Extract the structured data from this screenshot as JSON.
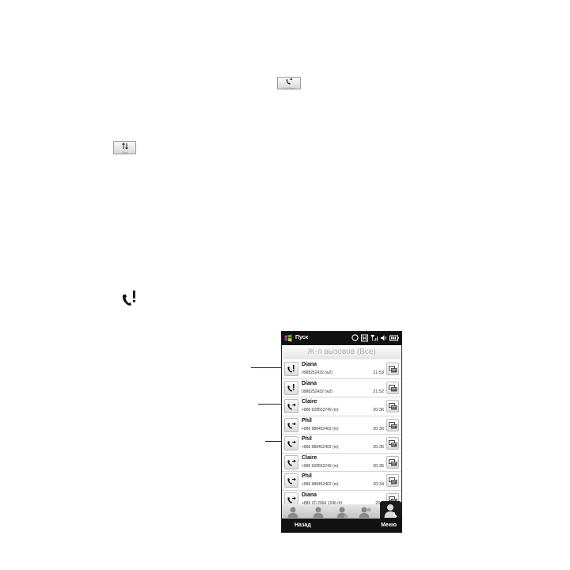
{
  "doc_icons": {
    "call_back_caption": "Call Back",
    "sort_caption": "Sort"
  },
  "phone": {
    "status_bar": {
      "start_label": "Пуск"
    },
    "title": "Ж-л вызовов (Все)",
    "calls": [
      {
        "name": "Diana",
        "number": "0988252432 (w2)",
        "time": "21:53",
        "type": "missed"
      },
      {
        "name": "Diana",
        "number": "0988252432 (w2)",
        "time": "21:52",
        "type": "missed"
      },
      {
        "name": "Claire",
        "number": "+886 928553749 (m)",
        "time": "20:36",
        "type": "outgoing"
      },
      {
        "name": "Phil",
        "number": "+886 988452402 (m)",
        "time": "20:36",
        "type": "outgoing"
      },
      {
        "name": "Phil",
        "number": "+886 988452402 (m)",
        "time": "20:35",
        "type": "outgoing"
      },
      {
        "name": "Claire",
        "number": "+886 928553749 (m)",
        "time": "20:35",
        "type": "outgoing"
      },
      {
        "name": "Phil",
        "number": "+886 988452402 (m)",
        "time": "20:34",
        "type": "outgoing"
      },
      {
        "name": "Diana",
        "number": "+886 (2) 2964 1246 (h)",
        "time": "20:3",
        "type": "outgoing"
      }
    ],
    "softkeys": {
      "left": "Назад",
      "right": "Меню"
    }
  },
  "colors": {
    "status_bar": "#111111",
    "title_text": "#b0b0b0",
    "border": "#222222"
  }
}
